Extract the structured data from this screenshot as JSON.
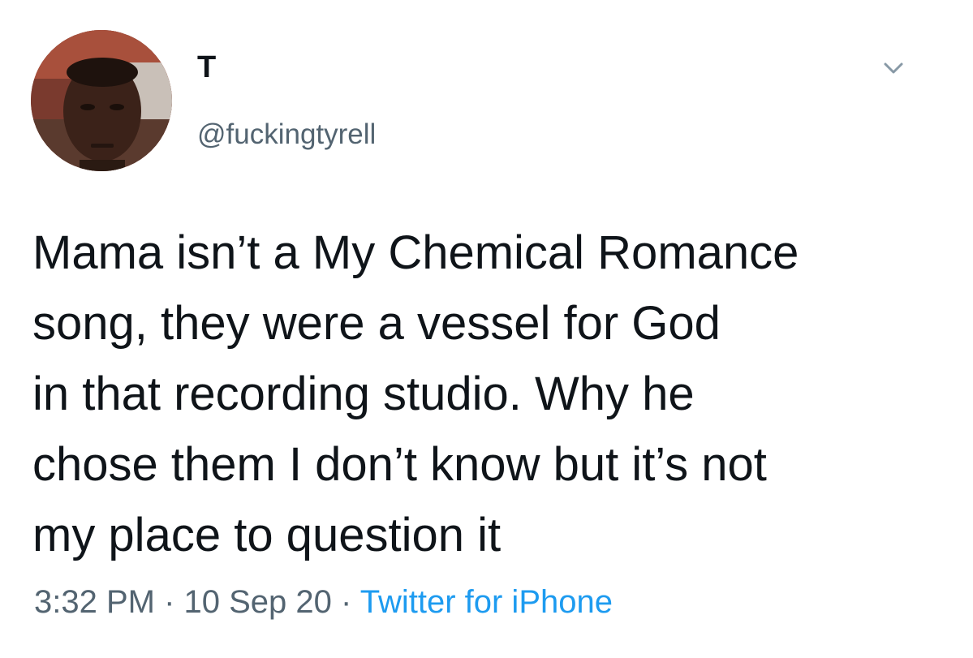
{
  "tweet": {
    "display_name": "T",
    "handle": "@fuckingtyrell",
    "text": "Mama isn’t a My Chemical Romance\nsong, they were a vessel for God\nin that recording studio. Why he\nchose them I don’t know but it’s not\nmy place to question it",
    "time": "3:32 PM",
    "separator": " · ",
    "date": "10 Sep 20",
    "source": "Twitter for iPhone"
  },
  "icons": {
    "avatar": "profile-photo",
    "menu": "chevron-down-icon"
  },
  "colors": {
    "text_primary": "#0f1419",
    "text_secondary": "#536471",
    "link": "#1d9bf0",
    "background": "#ffffff"
  }
}
